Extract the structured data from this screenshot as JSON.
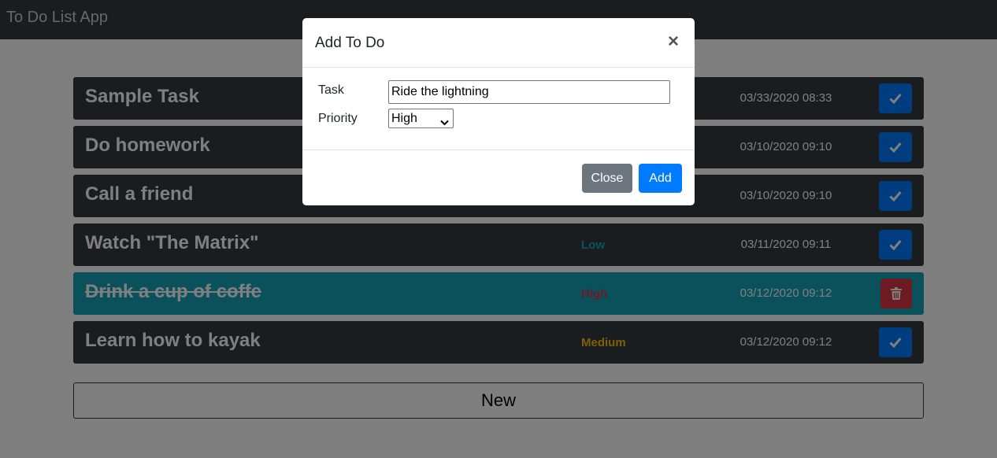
{
  "app": {
    "title": "To Do List App"
  },
  "todos": [
    {
      "title": "Sample Task",
      "priority": "",
      "priority_color": "",
      "timestamp": "03/33/2020 08:33",
      "done": false,
      "action": "check-icon"
    },
    {
      "title": "Do homework",
      "priority": "",
      "priority_color": "",
      "timestamp": "03/10/2020 09:10",
      "done": false,
      "action": "check-icon"
    },
    {
      "title": "Call a friend",
      "priority": "",
      "priority_color": "",
      "timestamp": "03/10/2020 09:10",
      "done": false,
      "action": "check-icon"
    },
    {
      "title": "Watch \"The Matrix\"",
      "priority": "Low",
      "priority_color": "#17a2b8",
      "timestamp": "03/11/2020 09:11",
      "done": false,
      "action": "check-icon"
    },
    {
      "title": "Drink a cup of coffe",
      "priority": "High",
      "priority_color": "#dc3545",
      "timestamp": "03/12/2020 09:12",
      "done": true,
      "action": "trash-icon"
    },
    {
      "title": "Learn how to kayak",
      "priority": "Medium",
      "priority_color": "#ffc107",
      "timestamp": "03/12/2020 09:12",
      "done": false,
      "action": "check-icon"
    }
  ],
  "new_button": {
    "label": "New"
  },
  "modal": {
    "title": "Add To Do",
    "close_symbol": "×",
    "task_label": "Task",
    "task_value": "Ride the lightning",
    "priority_label": "Priority",
    "priority_value": "High",
    "close_button": "Close",
    "add_button": "Add"
  },
  "colors": {
    "navbar": "#343a40",
    "row": "#343a40",
    "row_done": "#17a2b8",
    "primary": "#007bff",
    "danger": "#dc3545",
    "secondary": "#6c757d"
  }
}
